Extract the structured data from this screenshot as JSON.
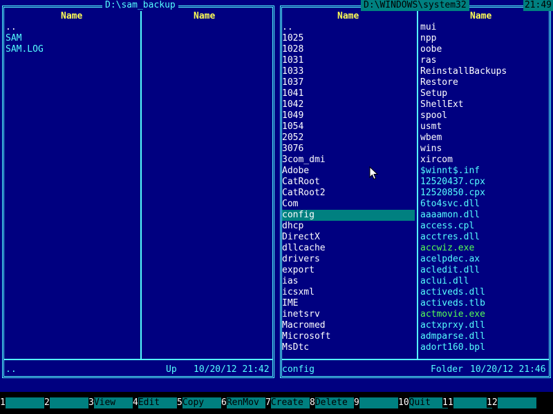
{
  "left_panel": {
    "path": "D:\\sam_backup",
    "col_header_1": "Name",
    "col_header_2": "Name",
    "items_col1": [
      {
        "name": "..",
        "type": "dir"
      },
      {
        "name": "SAM",
        "type": "file"
      },
      {
        "name": "SAM.LOG",
        "type": "file"
      }
    ],
    "status_name": "..",
    "status_info": "Up",
    "status_datetime": "10/20/12 21:42"
  },
  "right_panel": {
    "path": "D:\\WINDOWS\\system32",
    "clock": "21:49",
    "col_header_1": "Name",
    "col_header_2": "Name",
    "items_col1": [
      {
        "name": "..",
        "type": "dir"
      },
      {
        "name": "1025",
        "type": "dir"
      },
      {
        "name": "1028",
        "type": "dir"
      },
      {
        "name": "1031",
        "type": "dir"
      },
      {
        "name": "1033",
        "type": "dir"
      },
      {
        "name": "1037",
        "type": "dir"
      },
      {
        "name": "1041",
        "type": "dir"
      },
      {
        "name": "1042",
        "type": "dir"
      },
      {
        "name": "1049",
        "type": "dir"
      },
      {
        "name": "1054",
        "type": "dir"
      },
      {
        "name": "2052",
        "type": "dir"
      },
      {
        "name": "3076",
        "type": "dir"
      },
      {
        "name": "3com_dmi",
        "type": "dir"
      },
      {
        "name": "Adobe",
        "type": "dir"
      },
      {
        "name": "CatRoot",
        "type": "dir"
      },
      {
        "name": "CatRoot2",
        "type": "dir"
      },
      {
        "name": "Com",
        "type": "dir"
      },
      {
        "name": "config",
        "type": "dir",
        "selected": true
      },
      {
        "name": "dhcp",
        "type": "dir"
      },
      {
        "name": "DirectX",
        "type": "dir"
      },
      {
        "name": "dllcache",
        "type": "dir"
      },
      {
        "name": "drivers",
        "type": "dir"
      },
      {
        "name": "export",
        "type": "dir"
      },
      {
        "name": "ias",
        "type": "dir"
      },
      {
        "name": "icsxml",
        "type": "dir"
      },
      {
        "name": "IME",
        "type": "dir"
      },
      {
        "name": "inetsrv",
        "type": "dir"
      },
      {
        "name": "Macromed",
        "type": "dir"
      },
      {
        "name": "Microsoft",
        "type": "dir"
      },
      {
        "name": "MsDtc",
        "type": "dir"
      }
    ],
    "items_col2": [
      {
        "name": "mui",
        "type": "dir"
      },
      {
        "name": "npp",
        "type": "dir"
      },
      {
        "name": "oobe",
        "type": "dir"
      },
      {
        "name": "ras",
        "type": "dir"
      },
      {
        "name": "ReinstallBackups",
        "type": "dir"
      },
      {
        "name": "Restore",
        "type": "dir"
      },
      {
        "name": "Setup",
        "type": "dir"
      },
      {
        "name": "ShellExt",
        "type": "dir"
      },
      {
        "name": "spool",
        "type": "dir"
      },
      {
        "name": "usmt",
        "type": "dir"
      },
      {
        "name": "wbem",
        "type": "dir"
      },
      {
        "name": "wins",
        "type": "dir"
      },
      {
        "name": "xircom",
        "type": "dir"
      },
      {
        "name": "$winnt$.inf",
        "type": "file"
      },
      {
        "name": "12520437.cpx",
        "type": "file"
      },
      {
        "name": "12520850.cpx",
        "type": "file"
      },
      {
        "name": "6to4svc.dll",
        "type": "file"
      },
      {
        "name": "aaaamon.dll",
        "type": "file"
      },
      {
        "name": "access.cpl",
        "type": "file"
      },
      {
        "name": "acctres.dll",
        "type": "file"
      },
      {
        "name": "accwiz.exe",
        "type": "exe"
      },
      {
        "name": "acelpdec.ax",
        "type": "file"
      },
      {
        "name": "acledit.dll",
        "type": "file"
      },
      {
        "name": "aclui.dll",
        "type": "file"
      },
      {
        "name": "activeds.dll",
        "type": "file"
      },
      {
        "name": "activeds.tlb",
        "type": "file"
      },
      {
        "name": "actmovie.exe",
        "type": "exe"
      },
      {
        "name": "actxprxy.dll",
        "type": "file"
      },
      {
        "name": "admparse.dll",
        "type": "file"
      },
      {
        "name": "adort160.bpl",
        "type": "file"
      }
    ],
    "status_name": "config",
    "status_info": "Folder",
    "status_datetime": "10/20/12 21:46"
  },
  "keybar": [
    {
      "num": "1",
      "label": ""
    },
    {
      "num": "2",
      "label": ""
    },
    {
      "num": "3",
      "label": "View"
    },
    {
      "num": "4",
      "label": "Edit"
    },
    {
      "num": "5",
      "label": "Copy"
    },
    {
      "num": "6",
      "label": "RenMov"
    },
    {
      "num": "7",
      "label": "Create"
    },
    {
      "num": "8",
      "label": "Delete"
    },
    {
      "num": "9",
      "label": ""
    },
    {
      "num": "10",
      "label": "Quit"
    },
    {
      "num": "11",
      "label": ""
    },
    {
      "num": "12",
      "label": ""
    }
  ]
}
